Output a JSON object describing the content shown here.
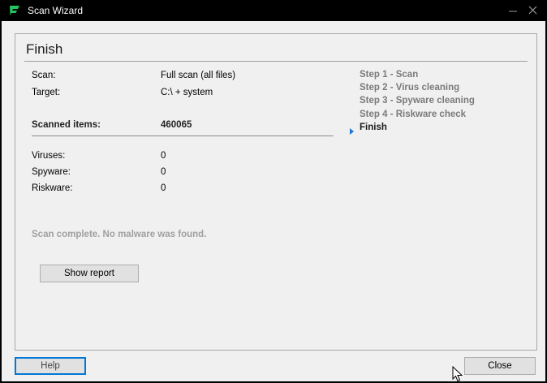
{
  "window": {
    "title": "Scan Wizard",
    "minimize_glyph": "—",
    "close_glyph": "✕"
  },
  "page": {
    "title": "Finish"
  },
  "summary": {
    "scan_label": "Scan:",
    "scan_value": "Full scan (all files)",
    "target_label": "Target:",
    "target_value": "C:\\  + system",
    "scanned_label": "Scanned items:",
    "scanned_value": "460065",
    "viruses_label": "Viruses:",
    "viruses_value": "0",
    "spyware_label": "Spyware:",
    "spyware_value": "0",
    "riskware_label": "Riskware:",
    "riskware_value": "0"
  },
  "status_message": "Scan complete. No malware was found.",
  "buttons": {
    "show_report": "Show report",
    "help": "Help",
    "close": "Close"
  },
  "steps": [
    {
      "label": "Step 1 - Scan",
      "current": false
    },
    {
      "label": "Step 2 - Virus cleaning",
      "current": false
    },
    {
      "label": "Step 3 - Spyware cleaning",
      "current": false
    },
    {
      "label": "Step 4 - Riskware check",
      "current": false
    },
    {
      "label": "Finish",
      "current": true
    }
  ],
  "icons": {
    "app": "shield-f-icon",
    "current_step": "triangle-right-icon",
    "cursor": "mouse-pointer-icon"
  },
  "colors": {
    "brand_green": "#22c55e",
    "accent_blue": "#0078d7",
    "titlebar": "#000000",
    "dialog_bg": "#f0f0f0"
  }
}
